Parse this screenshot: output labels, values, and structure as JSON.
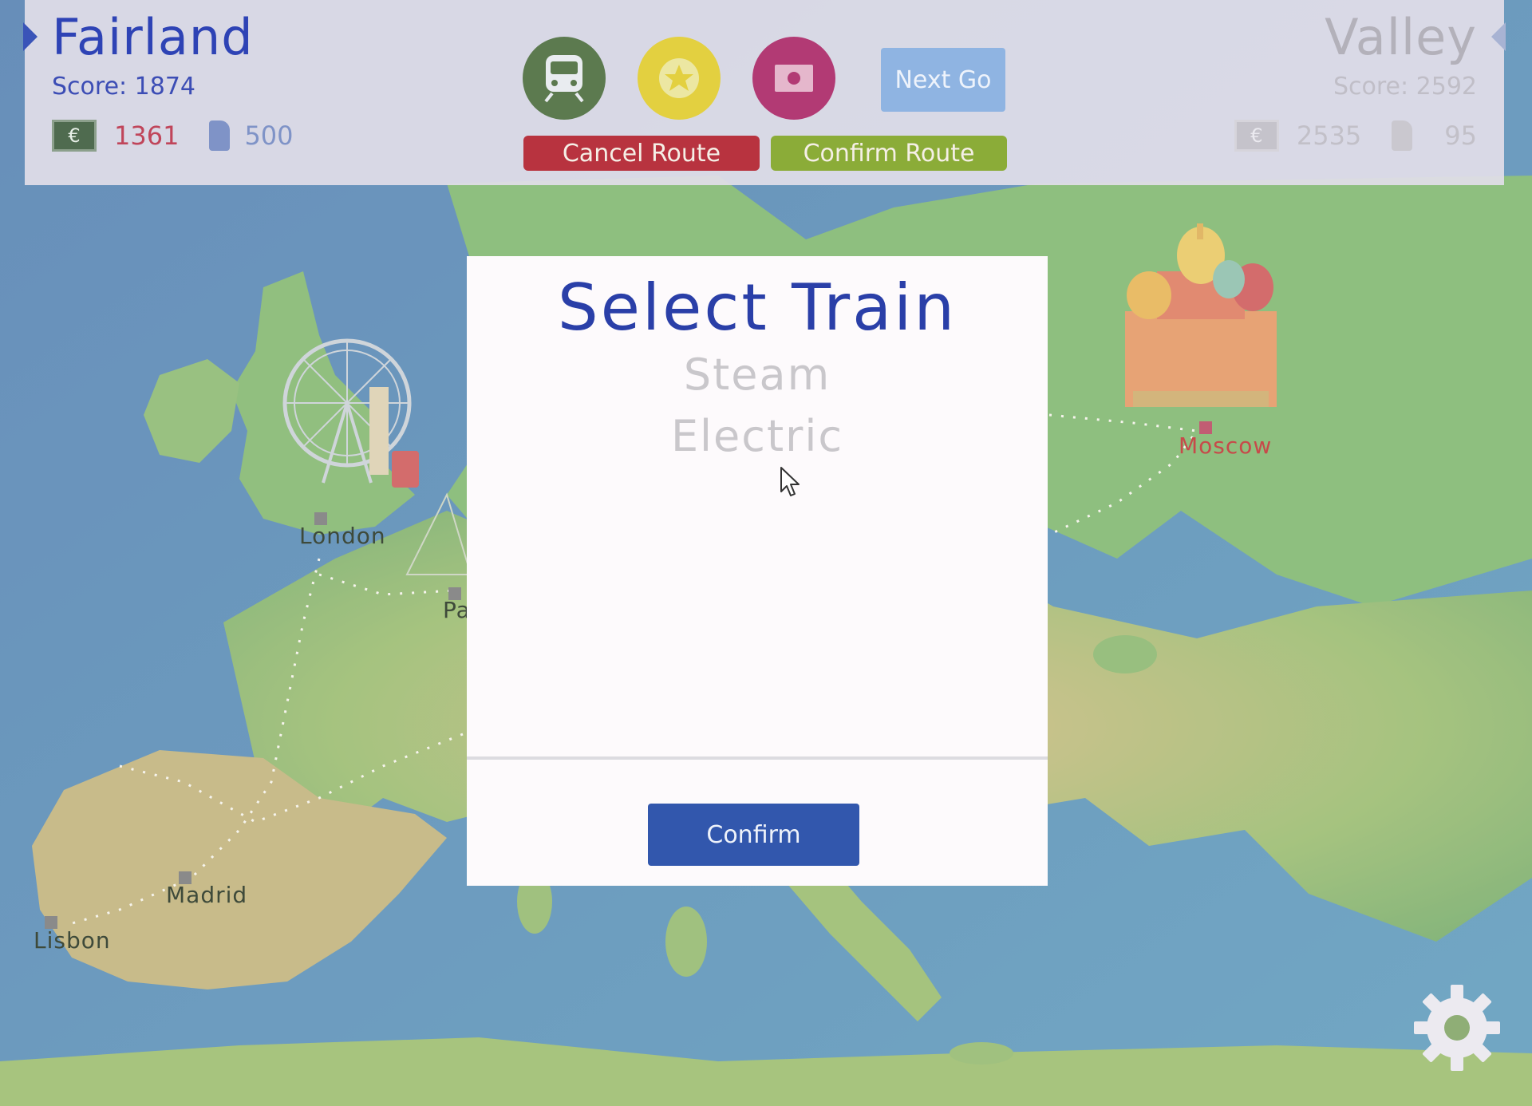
{
  "player_left": {
    "name": "Fairland",
    "score": "Score: 1874",
    "money_symbol": "€",
    "money": "1361",
    "fuel": "500"
  },
  "player_right": {
    "name": "Valley",
    "score": "Score: 2592",
    "money_symbol": "€",
    "money": "2535",
    "fuel": "95"
  },
  "toolbar": {
    "next_go": "Next Go",
    "cancel_route": "Cancel Route",
    "confirm_route": "Confirm Route"
  },
  "modal": {
    "title": "Select Train",
    "options": [
      "Steam",
      "Electric"
    ],
    "confirm": "Confirm"
  },
  "cities": [
    {
      "name": "London"
    },
    {
      "name": "Pa"
    },
    {
      "name": "Moscow"
    },
    {
      "name": "Madrid"
    },
    {
      "name": "Lisbon"
    }
  ],
  "colors": {
    "sea": "#3f7fae",
    "land": "#6aa85a",
    "player_left": "#2e43b5",
    "cancel": "#b8333f",
    "confirm_route": "#8bac38",
    "modal_confirm": "#3257ad"
  }
}
